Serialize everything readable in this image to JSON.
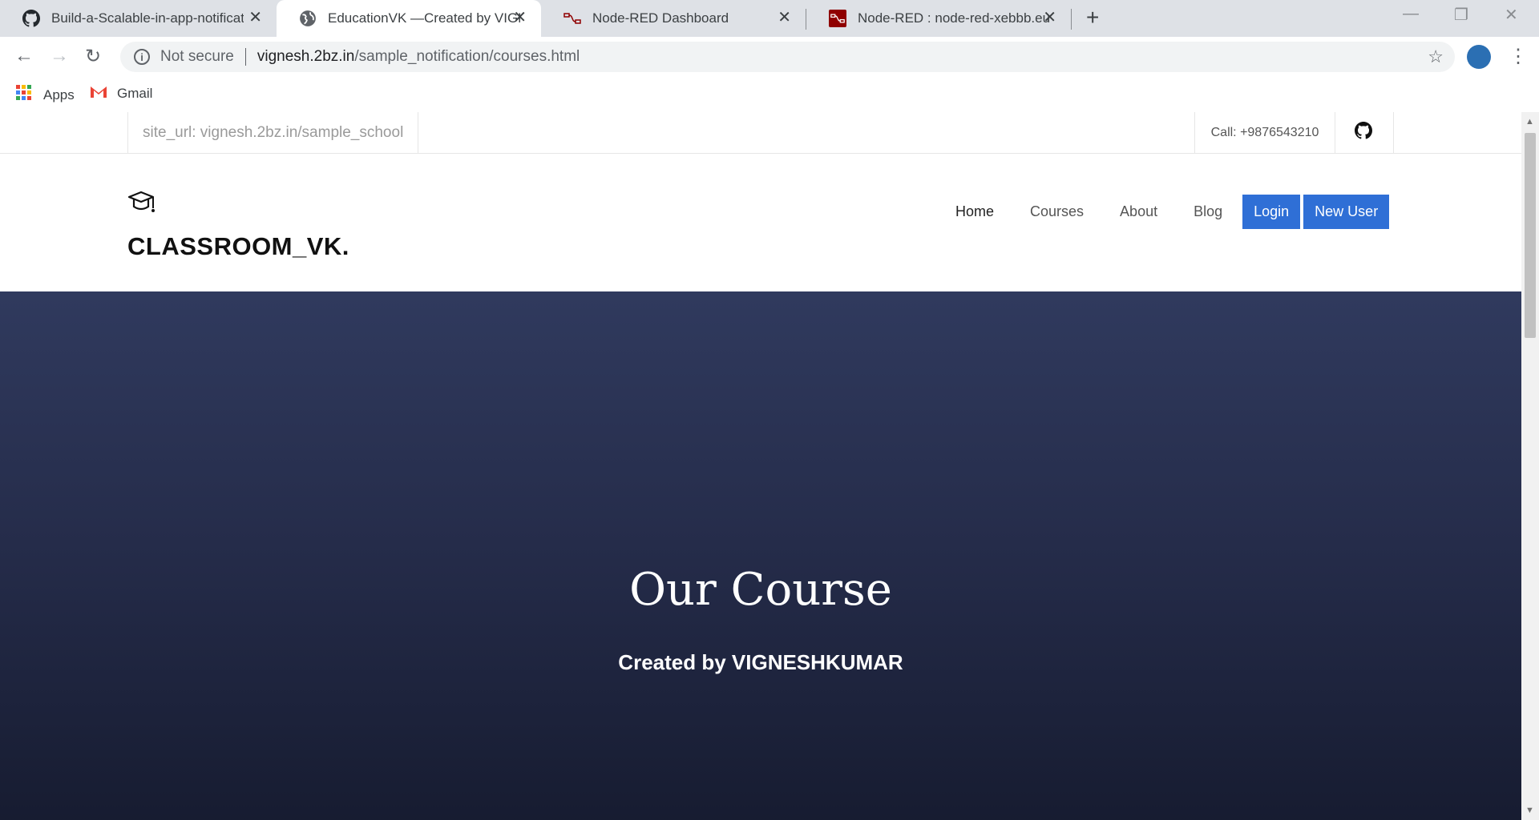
{
  "browser": {
    "tabs": [
      {
        "title": "Build-a-Scalable-in-app-notificati",
        "icon": "github-icon"
      },
      {
        "title": "EducationVK —Created by VIGNESHKUMAR",
        "icon": "globe-icon",
        "active": true
      },
      {
        "title": "Node-RED Dashboard",
        "icon": "node-red-icon"
      },
      {
        "title": "Node-RED : node-red-xebbb.eu-gb",
        "icon": "node-red-icon"
      }
    ],
    "security_label": "Not secure",
    "url_host": "vignesh.2bz.in",
    "url_path": "/sample_notification/courses.html",
    "bookmarks": [
      {
        "label": "Apps",
        "icon": "apps-grid-icon"
      },
      {
        "label": "Gmail",
        "icon": "gmail-icon"
      }
    ]
  },
  "page": {
    "site_url": "site_url: vignesh.2bz.in/sample_school",
    "call": "Call: +9876543210",
    "brand": "CLASSROOM_VK.",
    "nav": [
      "Home",
      "Courses",
      "About",
      "Blog"
    ],
    "login": "Login",
    "new_user": "New User",
    "hero_title": "Our Course",
    "hero_subtitle": "Created by VIGNESHKUMAR"
  },
  "colors": {
    "accent": "#2f6fd6",
    "hero_top": "#303a5e",
    "hero_bottom": "#151a2e"
  }
}
